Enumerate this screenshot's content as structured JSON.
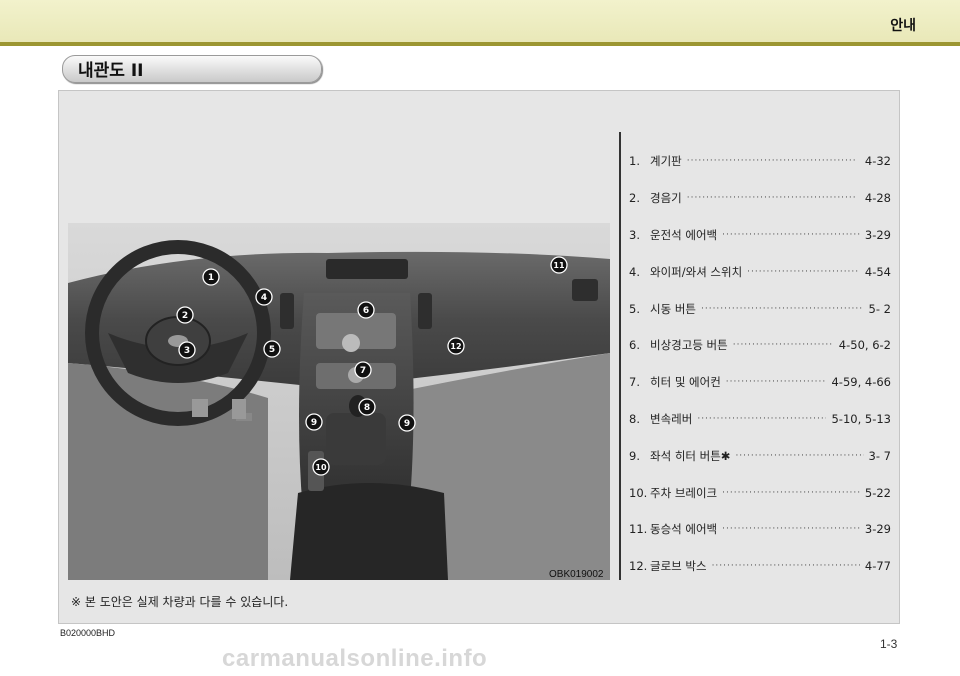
{
  "header": {
    "title": "안내"
  },
  "section": {
    "title": "내관도 II"
  },
  "figure": {
    "code": "OBK019002",
    "callouts": [
      "1",
      "2",
      "3",
      "4",
      "5",
      "6",
      "7",
      "8",
      "9",
      "9",
      "10",
      "11",
      "12"
    ]
  },
  "parts": [
    {
      "num": "1.",
      "name": "계기판",
      "dots": "············································",
      "page": "4-32"
    },
    {
      "num": "2.",
      "name": "경음기",
      "dots": "············································",
      "page": "4-28"
    },
    {
      "num": "3.",
      "name": "운전석 에어백",
      "dots": "············································",
      "page": "3-29"
    },
    {
      "num": "4.",
      "name": "와이퍼/와셔 스위치",
      "dots": "············································",
      "page": "4-54"
    },
    {
      "num": "5.",
      "name": "시동 버튼",
      "dots": "············································",
      "page": "5- 2"
    },
    {
      "num": "6.",
      "name": "비상경고등 버튼",
      "dots": "············································",
      "page": "4-50, 6-2"
    },
    {
      "num": "7.",
      "name": "히터 및 에어컨",
      "dots": "············································",
      "page": "4-59, 4-66"
    },
    {
      "num": "8.",
      "name": "변속레버",
      "dots": "············································",
      "page": "5-10, 5-13"
    },
    {
      "num": "9.",
      "name": "좌석 히터 버튼✱",
      "dots": "············································",
      "page": "3- 7"
    },
    {
      "num": "10.",
      "name": "주차 브레이크",
      "dots": "············································",
      "page": "5-22"
    },
    {
      "num": "11.",
      "name": "동승석 에어백",
      "dots": "············································",
      "page": "3-29"
    },
    {
      "num": "12.",
      "name": "글로브 박스",
      "dots": "············································",
      "page": "4-77"
    }
  ],
  "footnote": "※ 본 도안은 실제 차량과 다를 수 있습니다.",
  "doc_code": "B020000BHD",
  "page_number": "1-3",
  "watermark": "carmanualsonline.info"
}
